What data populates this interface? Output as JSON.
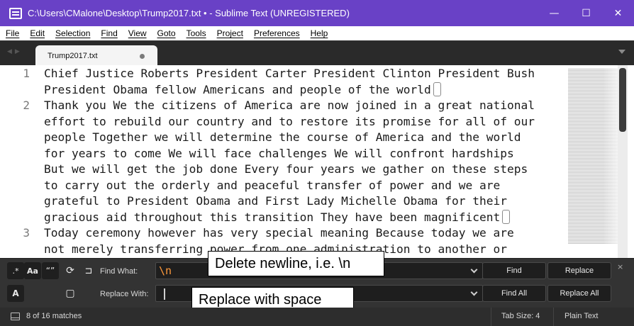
{
  "window": {
    "title": "C:\\Users\\CMalone\\Desktop\\Trump2017.txt • - Sublime Text (UNREGISTERED)",
    "minimize": "—",
    "maximize": "☐",
    "close": "✕"
  },
  "menu": [
    "File",
    "Edit",
    "Selection",
    "Find",
    "View",
    "Goto",
    "Tools",
    "Project",
    "Preferences",
    "Help"
  ],
  "tab": {
    "label": "Trump2017.txt",
    "modified": true
  },
  "editor": {
    "line_numbers": [
      "1",
      "2",
      "3"
    ],
    "wrapped_lines": [
      "Chief Justice Roberts President Carter President Clinton President Bush",
      "President Obama fellow Americans and people of the world",
      "Thank you We the citizens of America are now joined in a great national",
      "effort to rebuild our country and to restore its promise for all of our",
      "people Together we will determine the course of America and the world",
      "for years to come We will face challenges We will confront hardships",
      "But we will get the job done Every four years we gather on these steps",
      "to carry out the orderly and peaceful transfer of power and we are",
      "grateful to President Obama and First Lady Michelle Obama for their",
      "gracious aid throughout this transition They have been magnificent",
      "Today ceremony however has very special meaning Because today we are",
      "not merely transferring power from one administration to another or"
    ]
  },
  "find_panel": {
    "toggles": {
      "regex": ".*",
      "case": "Aa",
      "word": "“”",
      "wrap": "⟳",
      "in_selection": "⊐",
      "preserve_case": "A",
      "highlight": "▢"
    },
    "find_label": "Find What:",
    "find_value": "\\n",
    "replace_label": "Replace With:",
    "replace_value": "",
    "buttons": {
      "find": "Find",
      "replace": "Replace",
      "find_all": "Find All",
      "replace_all": "Replace All"
    },
    "close": "×"
  },
  "annotations": {
    "find_note": "Delete newline, i.e. \\n",
    "replace_note": "Replace with space"
  },
  "status": {
    "matches": "8 of 16 matches",
    "tab_size": "Tab Size: 4",
    "syntax": "Plain Text"
  },
  "colors": {
    "titlebar": "#6941c6",
    "regex_highlight": "#ff9a3c"
  }
}
